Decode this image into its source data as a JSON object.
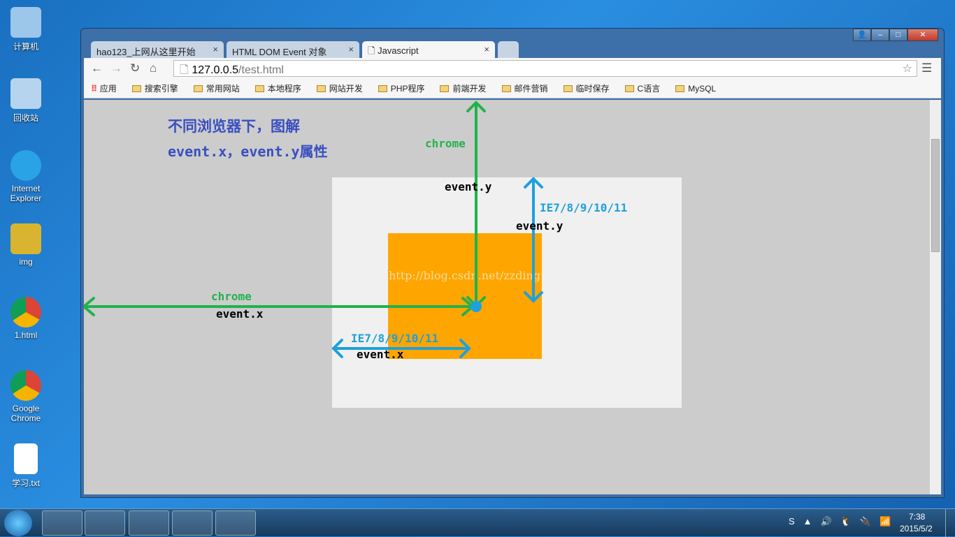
{
  "desktop": {
    "icons": [
      "计算机",
      "回收站",
      "Internet Explorer",
      "img",
      "1.html",
      "Google Chrome",
      "学习.txt"
    ]
  },
  "browser": {
    "tabs": [
      {
        "label": "hao123_上网从这里开始"
      },
      {
        "label": "HTML DOM Event 对象"
      },
      {
        "label": "Javascript"
      }
    ],
    "url_host": "127.0.0.5",
    "url_path": "/test.html",
    "bookmarks": [
      "应用",
      "搜索引擎",
      "常用网站",
      "本地程序",
      "网站开发",
      "PHP程序",
      "前端开发",
      "邮件营销",
      "临时保存",
      "C语言",
      "MySQL"
    ]
  },
  "page": {
    "title_line1": "不同浏览器下，图解",
    "title_line2": "event.x，event.y属性",
    "labels": {
      "chrome_y": "chrome",
      "chrome_y_prop": "event.y",
      "ie_y": "IE7/8/9/10/11",
      "ie_y_prop": "event.y",
      "chrome_x": "chrome",
      "chrome_x_prop": "event.x",
      "ie_x": "IE7/8/9/10/11",
      "ie_x_prop": "event.x"
    },
    "watermark": "http://blog.csdn.net/zzding",
    "colors": {
      "green": "#22b24c",
      "blue": "#1ea0dc",
      "orange": "#ffa500",
      "title": "#3a4fc0",
      "box": "#f0f0f0"
    }
  },
  "taskbar": {
    "time": "7:38",
    "date": "2015/5/2"
  }
}
